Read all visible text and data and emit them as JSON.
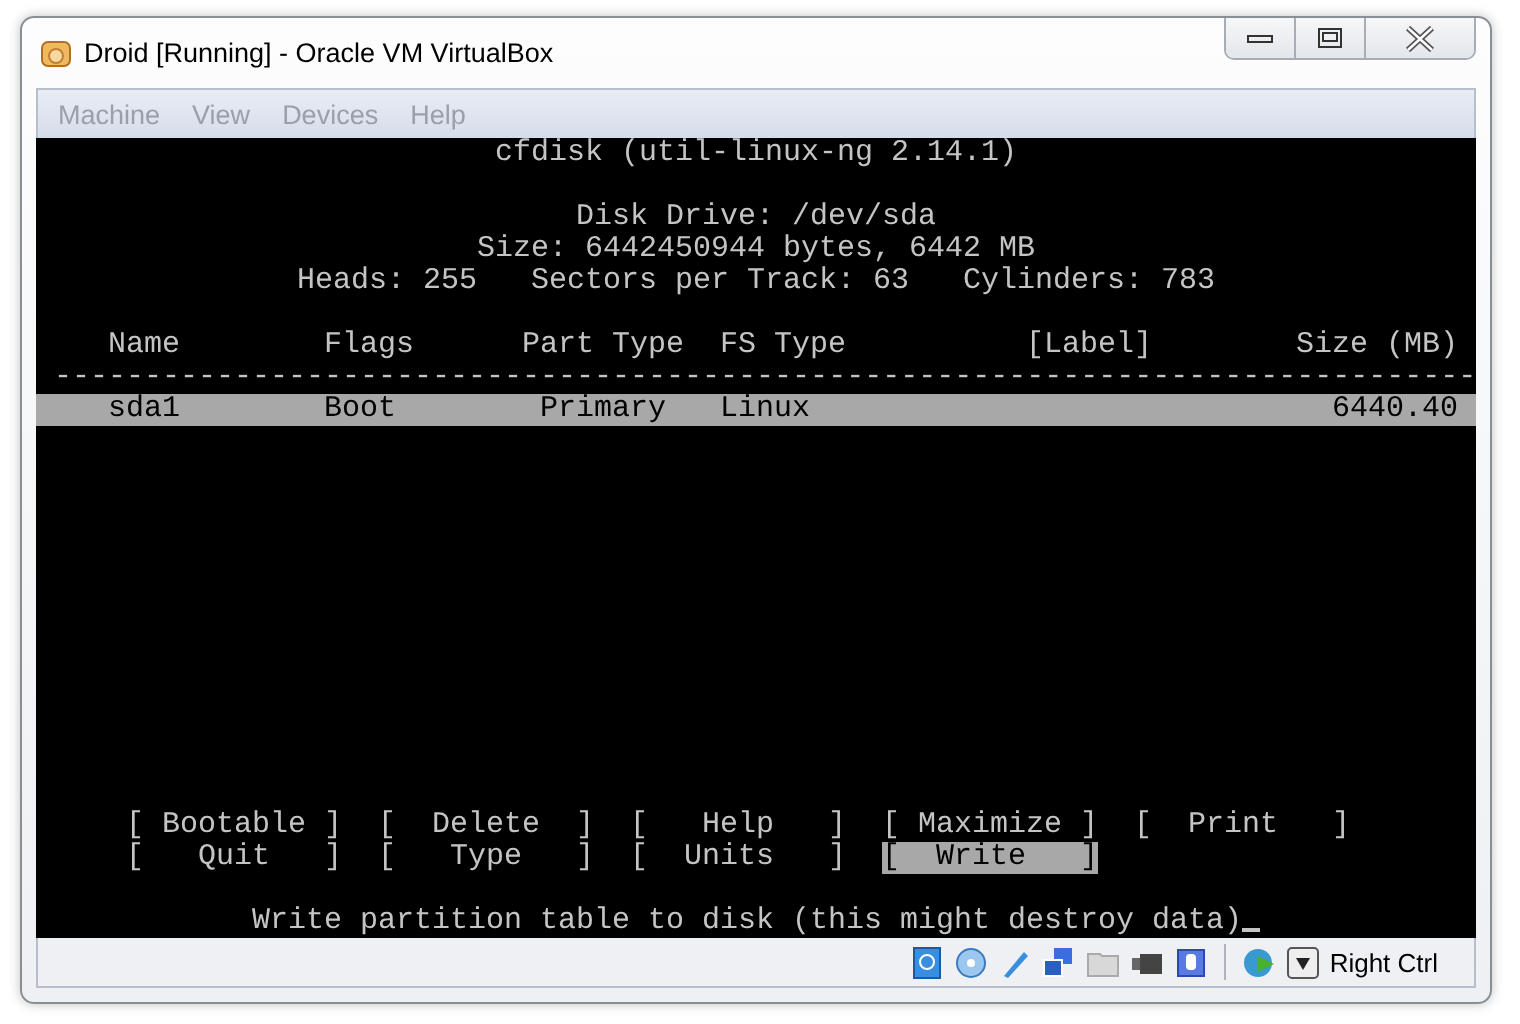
{
  "window": {
    "title": "Droid [Running] - Oracle VM VirtualBox"
  },
  "menu": [
    "Machine",
    "View",
    "Devices",
    "Help"
  ],
  "terminal": {
    "title": "cfdisk (util-linux-ng 2.14.1)",
    "disk_info": [
      "Disk Drive: /dev/sda",
      "Size: 6442450944 bytes, 6442 MB",
      "Heads: 255   Sectors per Track: 63   Cylinders: 783"
    ],
    "columns": [
      "Name",
      "Flags",
      "Part Type",
      "FS Type",
      "[Label]",
      "Size (MB)"
    ],
    "separator": "-------------------------------------------------------------------------------",
    "rows": [
      {
        "name": "sda1",
        "flags": "Boot",
        "part_type": "Primary",
        "fs_type": "Linux",
        "label": "",
        "size": "6440.40",
        "selected": true
      }
    ],
    "buttons": [
      [
        {
          "label": "[ Bootable ]",
          "selected": false
        },
        {
          "label": "[  Delete  ]",
          "selected": false
        },
        {
          "label": "[   Help   ]",
          "selected": false
        },
        {
          "label": "[ Maximize ]",
          "selected": false
        },
        {
          "label": "[  Print   ]",
          "selected": false
        }
      ],
      [
        {
          "label": "[   Quit   ]",
          "selected": false
        },
        {
          "label": "[   Type   ]",
          "selected": false
        },
        {
          "label": "[  Units   ]",
          "selected": false
        },
        {
          "label": "[  Write   ]",
          "selected": true
        }
      ]
    ],
    "message": "Write partition table to disk (this might destroy data)"
  },
  "status_bar": {
    "host_key": "Right Ctrl"
  }
}
